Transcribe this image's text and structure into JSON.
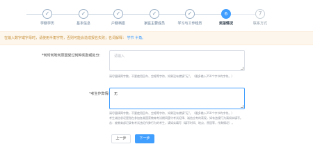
{
  "steps": [
    {
      "label": "学籍学历",
      "state": "done",
      "icon": "check-icon",
      "glyph": "✓"
    },
    {
      "label": "基本信息",
      "state": "done",
      "icon": "check-icon",
      "glyph": "✓"
    },
    {
      "label": "户籍档案",
      "state": "done",
      "icon": "check-icon",
      "glyph": "✓"
    },
    {
      "label": "家庭主要成员",
      "state": "done",
      "icon": "check-icon",
      "glyph": "✓"
    },
    {
      "label": "学习与工作经历",
      "state": "done",
      "icon": "check-icon",
      "glyph": "✓"
    },
    {
      "label": "奖惩情况",
      "state": "active",
      "number": "6"
    },
    {
      "label": "联系方式",
      "state": "pending",
      "number": "7"
    }
  ],
  "notice": {
    "text": "在输入数字或字母时，请使用半角字符，否则可能会造成报名失败；名词解释：",
    "links": "学节 半角。"
  },
  "form": {
    "q1": {
      "label": "*何时何地何原因受过何种奖励或处分：",
      "placeholder": "请输入",
      "value": "",
      "hint": "请尽量精简字数，不要使用回车、空格等字符，如果没有就填\"无\"。（最多输入250个字节的字符。）"
    },
    "q2": {
      "label": "*考生作弊情况：",
      "value": "无",
      "hint_lines": [
        "请尽量精简字数，不要使用回车、空格等字符，如果没有就填\"无\"。（最多输入250个字节的字符。）",
        "考生诚信状况是指在参加各类国家教育考试期间遵守考试纪律、诚信应考的表现，如有违规行为请如实填写。",
        "含：被教育部记录有考试违纪作弊行为的考生，请如实填写（填写时间、地点、原因等，作弊情况）。"
      ]
    }
  },
  "buttons": {
    "prev": "上一步",
    "next": "下一步"
  },
  "colors": {
    "primary": "#409eff",
    "notice_bg": "#fdf6ec",
    "notice_text": "#c7913b",
    "required": "#f56c6c"
  }
}
